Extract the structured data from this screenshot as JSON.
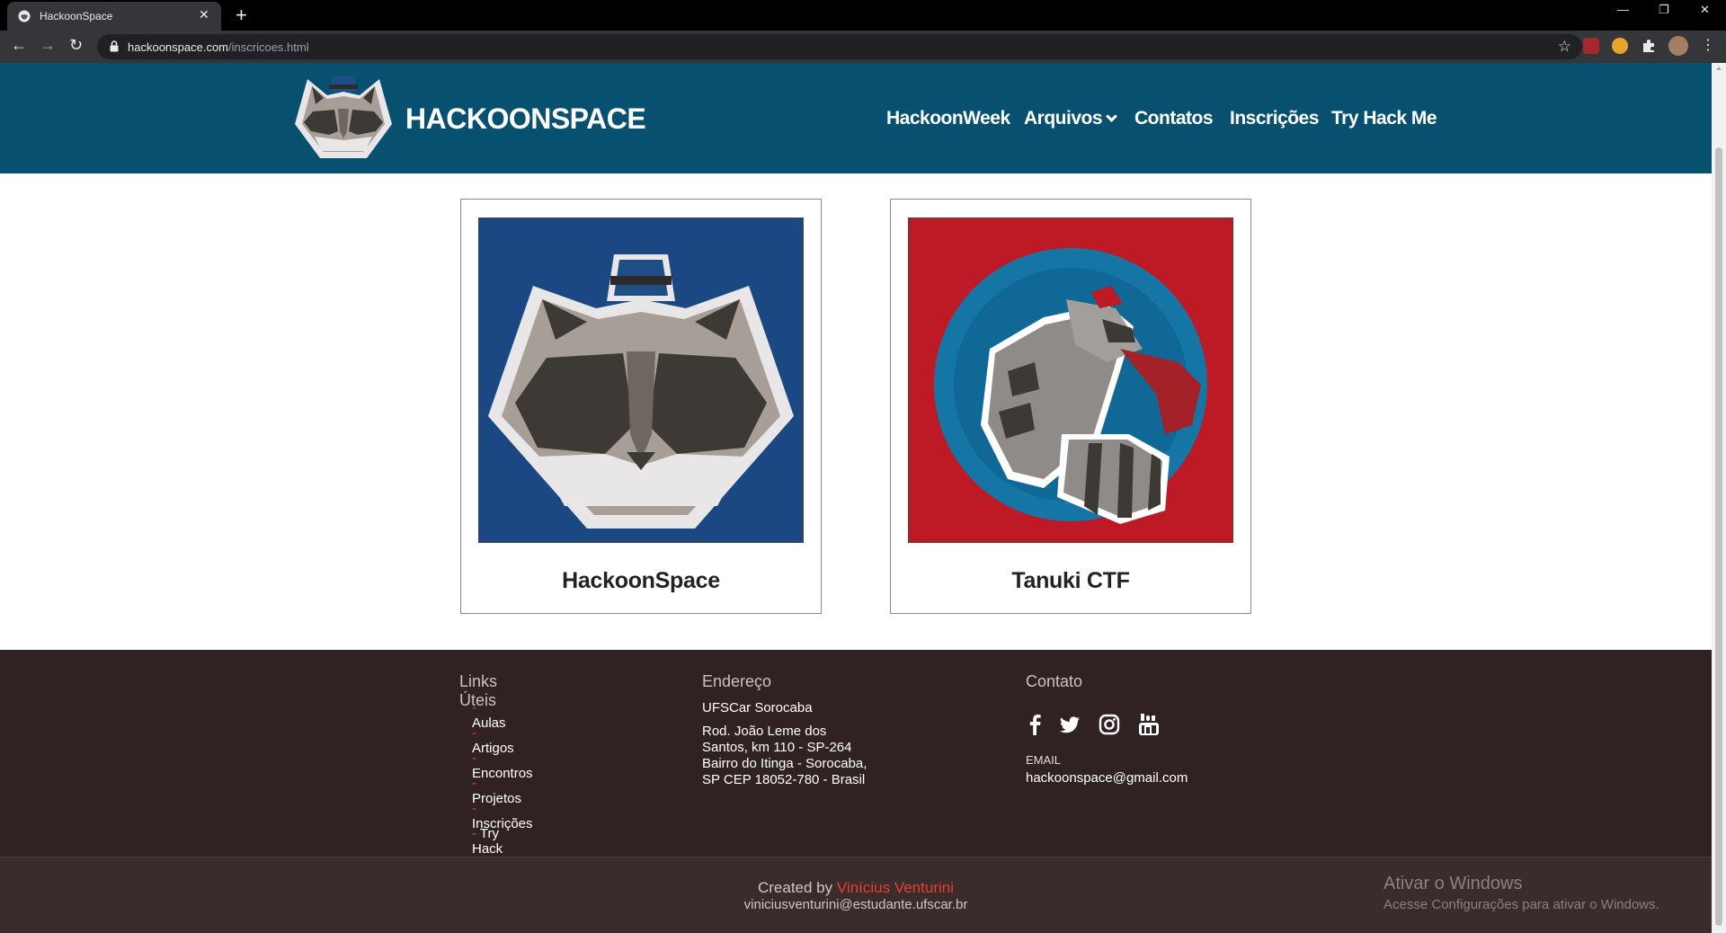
{
  "browser": {
    "tab_title": "HackoonSpace",
    "tab_close": "✕",
    "new_tab": "+",
    "url_host": "hackoonspace.com",
    "url_path": "/inscricoes.html",
    "back": "←",
    "forward": "→",
    "reload": "↻",
    "bookmark": "☆",
    "menu": "⋮",
    "minimize": "—",
    "restore": "❐",
    "close": "✕"
  },
  "header": {
    "brand": "HACKOONSPACE",
    "nav": [
      "HackoonWeek",
      "Arquivos",
      "Contatos",
      "Inscrições",
      "Try Hack Me"
    ]
  },
  "cards": [
    {
      "title": "HackoonSpace"
    },
    {
      "title": "Tanuki CTF"
    }
  ],
  "footer": {
    "links_title": "Links Úteis",
    "links": [
      "Aulas",
      "Artigos",
      "Encontros",
      "Projetos",
      "Inscrições",
      "Try Hack Me"
    ],
    "link_dash": "-",
    "address_title": "Endereço",
    "address_name": "UFSCar Sorocaba",
    "address_lines": [
      "Rod. João Leme dos",
      "Santos, km 110 - SP-264",
      "Bairro do Itinga - Sorocaba,",
      "SP CEP 18052-780 - Brasil"
    ],
    "contact_title": "Contato",
    "email_label": "EMAIL",
    "email": "hackoonspace@gmail.com",
    "social_icons": [
      "facebook-icon",
      "twitter-icon",
      "instagram-icon",
      "youtube-icon"
    ]
  },
  "bottom": {
    "created_by": "Created by",
    "author": "Vinícius Venturini",
    "author_email": "viniciusventurini@estudante.ufscar.br",
    "watermark_title": "Ativar o Windows",
    "watermark_text": "Acesse Configurações para ativar o Windows."
  },
  "colors": {
    "header_bg": "#08506f",
    "footer_bg": "#302223",
    "accent": "#e8402a",
    "card1_bg": "#1b4882",
    "card2_bg": "#be1a26"
  }
}
